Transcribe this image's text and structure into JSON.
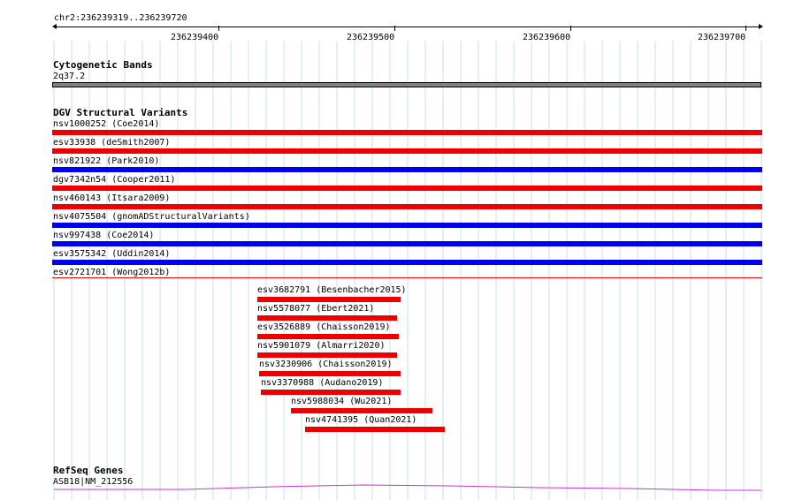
{
  "browser": {
    "position": "chr2:236239319..236239720",
    "ticks": [
      "236239400",
      "236239500",
      "236239600",
      "236239700"
    ],
    "grid_color": "#c0e4f0",
    "gain_color": "#0000ee",
    "loss_color": "#ee0000"
  },
  "cyto_track": {
    "title": "Cytogenetic Bands",
    "band": "2q37.2"
  },
  "dgv_track": {
    "title": "DGV Structural Variants",
    "variants": [
      {
        "label": "nsv1000252 (Coe2014)",
        "kind": "loss"
      },
      {
        "label": "esv33938 (deSmith2007)",
        "kind": "loss"
      },
      {
        "label": "nsv821922 (Park2010)",
        "kind": "gain"
      },
      {
        "label": "dgv7342n54 (Cooper2011)",
        "kind": "loss"
      },
      {
        "label": "nsv460143 (Itsara2009)",
        "kind": "loss"
      },
      {
        "label": "nsv4075504 (gnomADStructuralVariants)",
        "kind": "gain"
      },
      {
        "label": "nsv997438 (Coe2014)",
        "kind": "gain"
      },
      {
        "label": "esv3575342 (Uddin2014)",
        "kind": "gain"
      },
      {
        "label": "esv2721701 (Wong2012b)",
        "kind": "loss"
      }
    ],
    "small_variants": [
      {
        "label": "esv3682791 (Besenbacher2015)",
        "kind": "loss"
      },
      {
        "label": "nsv5578077 (Ebert2021)",
        "kind": "loss"
      },
      {
        "label": "esv3526889 (Chaisson2019)",
        "kind": "loss"
      },
      {
        "label": "nsv5901079 (Almarri2020)",
        "kind": "loss"
      },
      {
        "label": "nsv3230906 (Chaisson2019)",
        "kind": "loss"
      },
      {
        "label": "nsv3370988 (Audano2019)",
        "kind": "loss"
      },
      {
        "label": "nsv5988034 (Wu2021)",
        "kind": "loss"
      },
      {
        "label": "nsv4741395 (Quan2021)",
        "kind": "loss"
      }
    ]
  },
  "refseq_track": {
    "title": "RefSeq Genes",
    "gene": "ASB18|NM_212556",
    "color": "#cc33cc"
  }
}
